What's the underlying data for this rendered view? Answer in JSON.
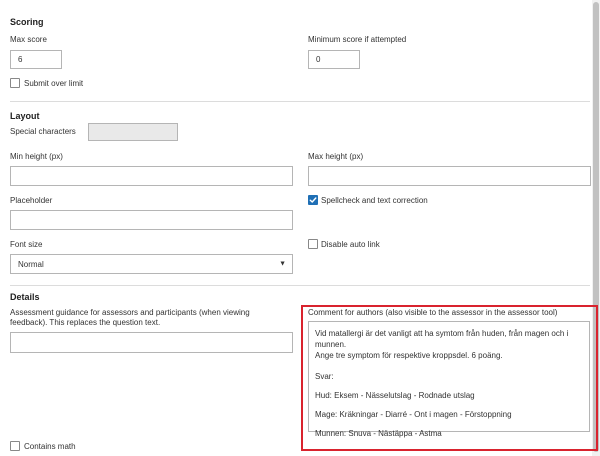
{
  "scoring": {
    "title": "Scoring",
    "max_score_label": "Max score",
    "max_score_value": "6",
    "min_score_label": "Minimum score if attempted",
    "min_score_value": "0",
    "submit_over_limit_label": "Submit over limit"
  },
  "layout": {
    "title": "Layout",
    "special_chars_label": "Special characters",
    "min_height_label": "Min height (px)",
    "min_height_value": "",
    "max_height_label": "Max height (px)",
    "max_height_value": "",
    "placeholder_label": "Placeholder",
    "placeholder_value": "",
    "spellcheck_label": "Spellcheck and text correction",
    "spellcheck_checked": true,
    "font_size_label": "Font size",
    "font_size_value": "Normal",
    "disable_autolink_label": "Disable auto link"
  },
  "details": {
    "title": "Details",
    "guidance_label_line1": "Assessment guidance for assessors and participants (when viewing",
    "guidance_label_line2": "feedback). This replaces the question text.",
    "guidance_value": "",
    "comment_label": "Comment for authors (also visible to the assessor in the assessor tool)",
    "comment_lines": [
      "Vid matallergi är det vanligt att ha symtom från huden, från magen och i munnen.",
      "Ange tre symptom för respektive kroppsdel. 6 poäng.",
      "Svar:",
      "Hud: Eksem - Nässelutslag - Rodnade utslag",
      "Mage: Kräkningar - Diarré - Ont i magen - Förstoppning",
      "Munnen: Snuva - Nästäppa - Astma"
    ],
    "contains_math_label": "Contains math"
  },
  "colors": {
    "highlight": "#d9232e",
    "checkbox_checked": "#1f6fb5"
  }
}
